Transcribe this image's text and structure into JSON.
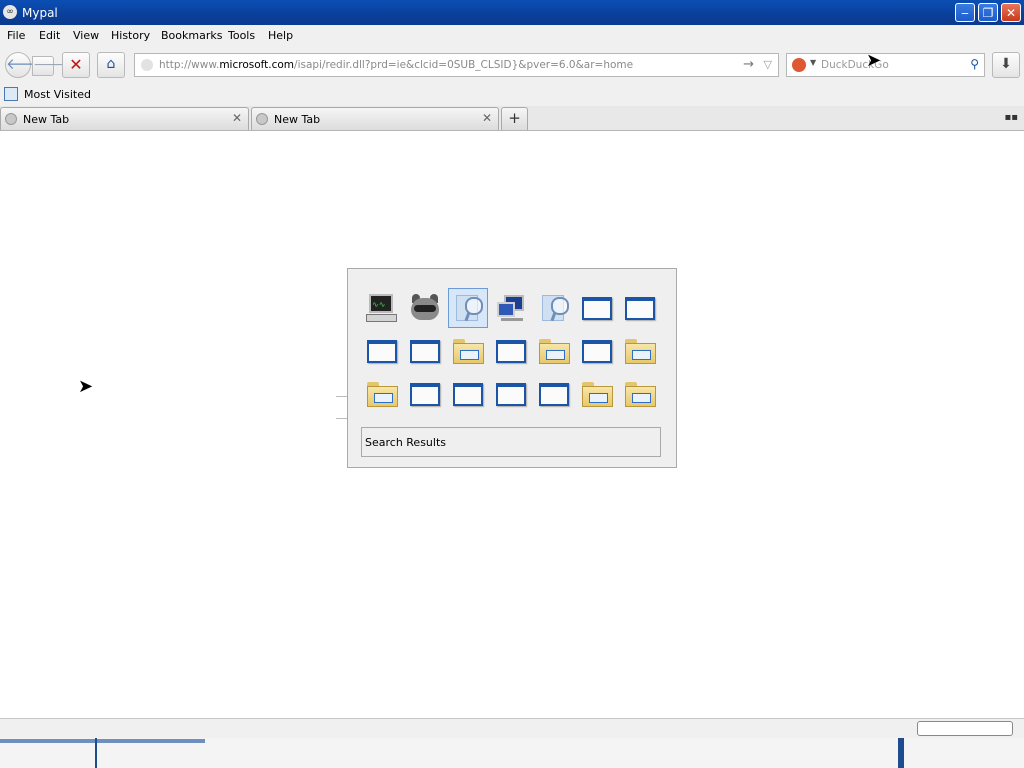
{
  "window": {
    "title": "Mypal",
    "minimize": "‒",
    "maximize": "❐",
    "close": "✕"
  },
  "menu": [
    "File",
    "Edit",
    "View",
    "History",
    "Bookmarks",
    "Tools",
    "Help"
  ],
  "nav": {
    "back_icon": "back-arrow-icon",
    "forward_icon": "forward-arrow-icon",
    "url_domain_prefix": "http://www.",
    "url_domain": "microsoft.com",
    "url_path": "/isapi/redir.dll?prd=ie&clcid=0SUB_CLSID}&pver=6.0&ar=home",
    "search_placeholder": "DuckDuckGo"
  },
  "bookmarks": {
    "most_visited": "Most Visited"
  },
  "tabs": [
    {
      "label": "New Tab"
    },
    {
      "label": "New Tab"
    }
  ],
  "switcher": {
    "rows": [
      [
        "monitor",
        "raccoon",
        "search-folder",
        "network",
        "search-folder",
        "window",
        "window"
      ],
      [
        "window",
        "window",
        "folder",
        "window",
        "folder",
        "window",
        "folder"
      ],
      [
        "folder",
        "window",
        "window",
        "window",
        "window",
        "folder",
        "folder"
      ]
    ],
    "selected": [
      0,
      2
    ],
    "label": "Search Results"
  },
  "colors": {
    "titlebar": "#0a4fb5",
    "window_icon_border": "#1b55a8",
    "folder": "#e8c86a"
  },
  "taskbar": {
    "progress": 0.2
  }
}
